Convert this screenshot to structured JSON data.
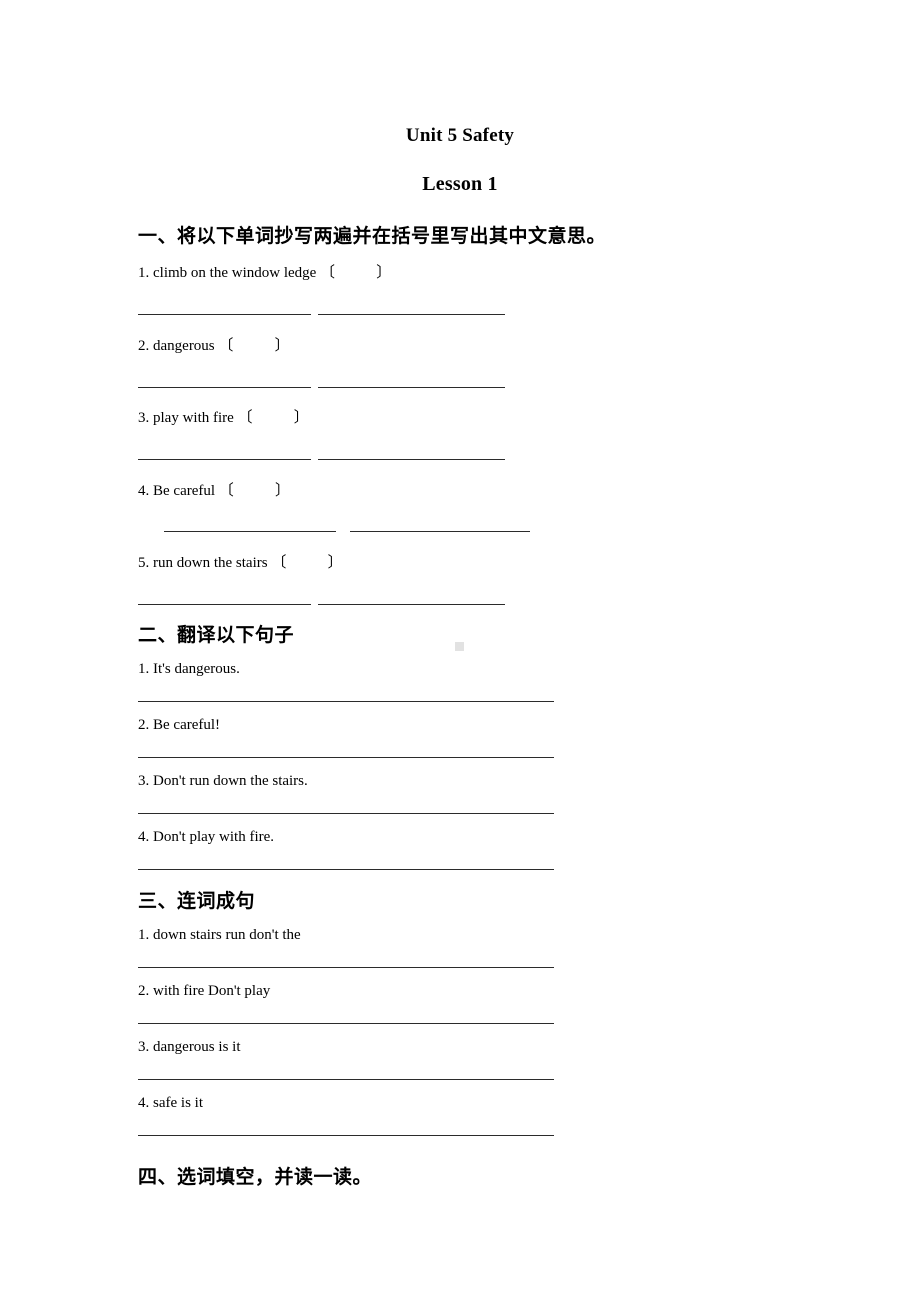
{
  "document": {
    "title": "Unit 5 Safety",
    "subtitle": "Lesson 1"
  },
  "sections": [
    {
      "heading": "一、将以下单词抄写两遍并在括号里写出其中文意思。",
      "items": [
        {
          "number": "1.",
          "text": "climb on the window ledge",
          "open_paren": "〔",
          "close_paren": "〕"
        },
        {
          "number": "2.",
          "text": "dangerous",
          "open_paren": "〔",
          "close_paren": "〕"
        },
        {
          "number": "3.",
          "text": "play with fire",
          "open_paren": "〔",
          "close_paren": "〕"
        },
        {
          "number": "4.",
          "text": "Be careful",
          "open_paren": "〔",
          "close_paren": "〕"
        },
        {
          "number": "5.",
          "text": "run down the stairs",
          "open_paren": "〔",
          "close_paren": "〕"
        }
      ]
    },
    {
      "heading": "二、翻译以下句子",
      "items": [
        {
          "number": "1.",
          "text": "It's dangerous."
        },
        {
          "number": "2.",
          "text": "Be careful!"
        },
        {
          "number": "3.",
          "text": "Don't run down the stairs."
        },
        {
          "number": "4.",
          "text": "Don't play with fire."
        }
      ]
    },
    {
      "heading": "三、连词成句",
      "items": [
        {
          "number": "1.",
          "text": "down stairs run don't the"
        },
        {
          "number": "2.",
          "text": "with fire Don't play"
        },
        {
          "number": "3.",
          "text": "dangerous is it"
        },
        {
          "number": "4.",
          "text": "safe is it"
        }
      ]
    },
    {
      "heading": "四、选词填空，并读一读。",
      "items": []
    }
  ],
  "lines": {
    "s1_item1_text": "1. climb on the window ledge 〔           〕",
    "s1_item2_text": "2. dangerous 〔           〕",
    "s1_item3_text": "3. play with fire 〔           〕",
    "s1_item4_text": "4. Be careful 〔           〕",
    "s1_item5_text": "5. run down the stairs 〔           〕",
    "s2_item1_text": "1. It's dangerous.",
    "s2_item2_text": "2. Be careful!",
    "s2_item3_text": "3. Don't run down the stairs.",
    "s2_item4_text": "4. Don't play with fire.",
    "s3_item1_text": "1. down stairs run don't the",
    "s3_item2_text": "2. with fire Don't play",
    "s3_item3_text": "3. dangerous is it",
    "s3_item4_text": "4. safe is it"
  },
  "colors": {
    "page_background": "#ffffff",
    "text": "#000000",
    "rule": "#2b2b2b",
    "speck": "#e2e2e2"
  }
}
